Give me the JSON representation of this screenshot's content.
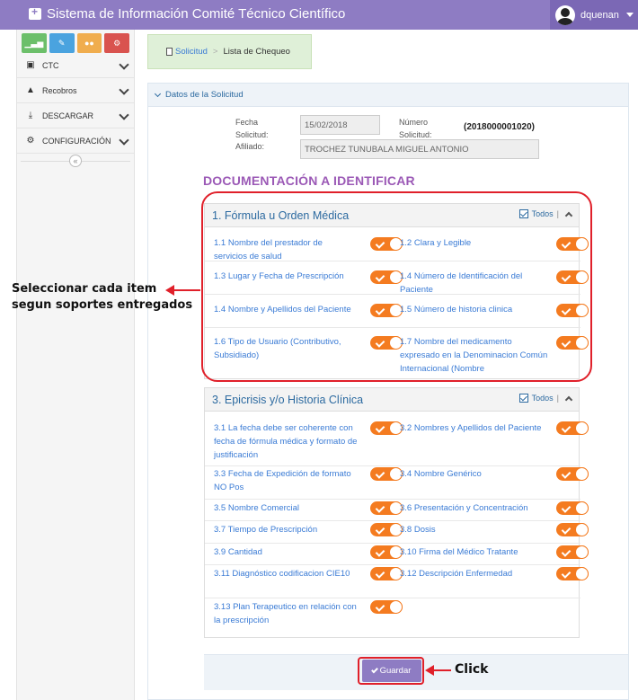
{
  "app": {
    "title": "Sistema de Información Comité Técnico Científico",
    "user": "dquenan",
    "accent_color": "#8e7cc3"
  },
  "sidebar": {
    "shortcuts": [
      {
        "icon": "signal-icon",
        "color": "#6cbf6a"
      },
      {
        "icon": "pencil-icon",
        "color": "#4aa3df"
      },
      {
        "icon": "users-icon",
        "color": "#f0ad4e"
      },
      {
        "icon": "cogs-icon",
        "color": "#d9534f"
      }
    ],
    "items": [
      {
        "label": "CTC",
        "icon": "medkit-icon"
      },
      {
        "label": "Recobros",
        "icon": "bell-icon"
      },
      {
        "label": "DESCARGAR",
        "icon": "download-icon"
      },
      {
        "label": "CONFIGURACIÓN",
        "icon": "cogs-icon"
      }
    ],
    "collapse_glyph": "«"
  },
  "breadcrumb": {
    "link": "Solicitud",
    "current": "Lista de Chequeo"
  },
  "panel": {
    "title": "Datos de la Solicitud",
    "fecha_label": "Fecha Solicitud:",
    "fecha_value": "15/02/2018",
    "numero_label": "Número Solicitud:",
    "numero_value": "(2018000001020)",
    "afiliado_label": "Afiliado:",
    "afiliado_value": "TROCHEZ TUNUBALA MIGUEL ANTONIO",
    "section_title": "DOCUMENTACIÓN A IDENTIFICAR"
  },
  "groups": [
    {
      "title": "1. Fórmula u Orden Médica",
      "todos_label": "Todos",
      "items": [
        {
          "left": "1.1 Nombre del prestador de servicios de salud",
          "right": "1.2 Clara y Legible"
        },
        {
          "left": "1.3 Lugar y Fecha de Prescripción",
          "right": "1.4 Número de Identificación del Paciente"
        },
        {
          "left": "1.4 Nombre y Apellidos del Paciente",
          "right": "1.5 Número de historia clinica"
        },
        {
          "left": "1.6 Tipo de Usuario (Contributivo, Subsidiado)",
          "right": "1.7 Nombre del medicamento expresado en la Denominacion Común Internacional (Nombre"
        }
      ]
    },
    {
      "title": "3. Epicrisis y/o Historia Clínica",
      "todos_label": "Todos",
      "items": [
        {
          "left": "3.1 La fecha debe ser coherente con fecha de fórmula médica y formato de justificación",
          "right": "3.2 Nombres y Apellidos del Paciente"
        },
        {
          "left": "3.3 Fecha de Expedición de formato NO Pos",
          "right": "3.4 Nombre Genérico"
        },
        {
          "left": "3.5 Nombre Comercial",
          "right": "3.6 Presentación y Concentración"
        },
        {
          "left": "3.7 Tiempo de Prescripción",
          "right": "3.8 Dosis"
        },
        {
          "left": "3.9 Cantidad",
          "right": "3.10 Firma del Médico Tratante"
        },
        {
          "left": "3.11 Diagnóstico codificacion CIE10",
          "right": "3.12 Descripción Enfermedad"
        },
        {
          "left": "3.13 Plan Terapeutico en relación con la prescripción",
          "right": ""
        }
      ]
    }
  ],
  "actions": {
    "save_label": "Guardar"
  },
  "annotations": {
    "select_note_line1": "Seleccionar cada item",
    "select_note_line2": "segun soportes entregados",
    "click_note": "Click",
    "color": "#e0202a"
  }
}
